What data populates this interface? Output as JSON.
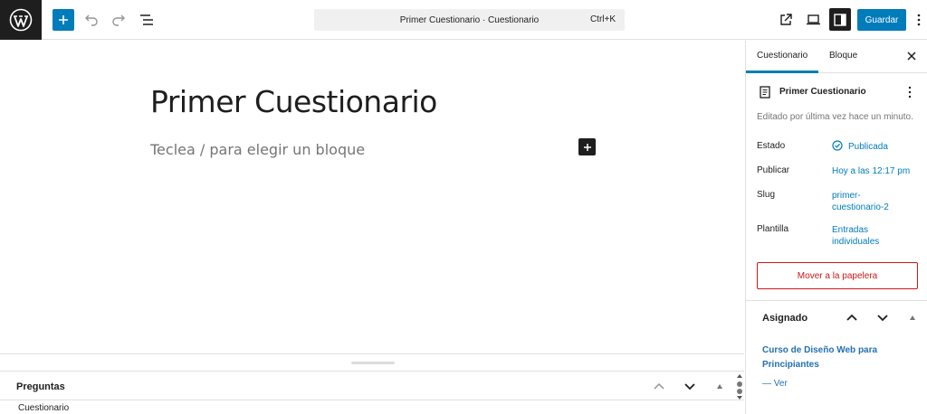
{
  "topbar": {
    "logo_icon": "wordpress-logo-icon",
    "command_title": "Primer Cuestionario · Cuestionario",
    "command_shortcut": "Ctrl+K",
    "save_label": "Guardar",
    "accent_color": "#007cba"
  },
  "editor": {
    "post_title": "Primer Cuestionario",
    "block_placeholder": "Teclea / para elegir un bloque"
  },
  "meta_panel": {
    "title": "Preguntas",
    "subtitle": "Cuestionario"
  },
  "sidebar": {
    "tabs": [
      {
        "label": "Cuestionario",
        "active": true
      },
      {
        "label": "Bloque",
        "active": false
      }
    ],
    "post_card": {
      "title": "Primer Cuestionario",
      "description": "Editado por última vez hace un minuto."
    },
    "rows": {
      "status_label": "Estado",
      "status_value": "Publicada",
      "publish_label": "Publicar",
      "publish_value": "Hoy a las 12:17 pm",
      "slug_label": "Slug",
      "slug_value_1": "primer-",
      "slug_value_2": "cuestionario-2",
      "template_label": "Plantilla",
      "template_value_1": "Entradas",
      "template_value_2": "individuales"
    },
    "trash_label": "Mover a la papelera",
    "assigned": {
      "title": "Asignado",
      "course_line_1": "Curso de Diseño Web para",
      "course_line_2": "Principiantes",
      "view_link": "— Ver"
    }
  }
}
